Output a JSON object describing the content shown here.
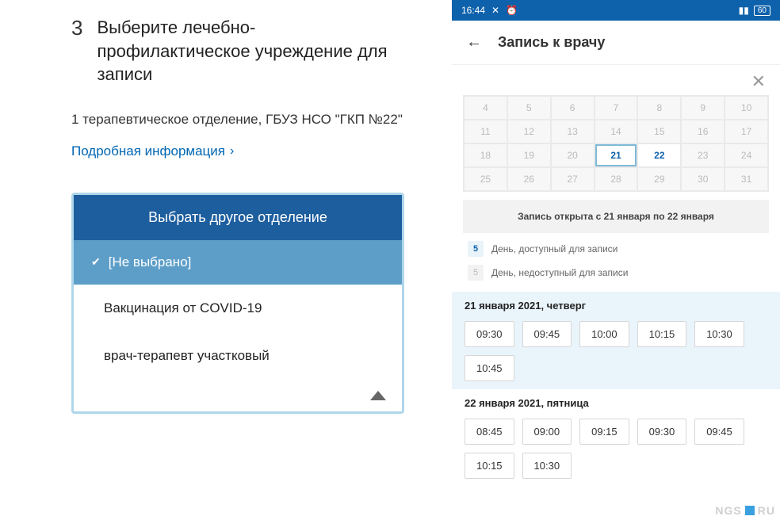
{
  "left": {
    "step_number": "3",
    "step_title": "Выберите лечебно-профилактическое учреждение для записи",
    "department": "1 терапевтическое отделение, ГБУЗ НСО \"ГКП №22\"",
    "details_link": "Подробная информация",
    "dropdown": {
      "header": "Выбрать другое отделение",
      "selected": "[Не выбрано]",
      "options": [
        "Вакцинация от COVID-19",
        "врач-терапевт участковый"
      ]
    }
  },
  "right": {
    "status": {
      "time": "16:44",
      "battery": "60"
    },
    "appbar_title": "Запись к врачу",
    "calendar": {
      "cells": [
        {
          "d": "4"
        },
        {
          "d": "5"
        },
        {
          "d": "6"
        },
        {
          "d": "7"
        },
        {
          "d": "8"
        },
        {
          "d": "9"
        },
        {
          "d": "10"
        },
        {
          "d": "11"
        },
        {
          "d": "12"
        },
        {
          "d": "13"
        },
        {
          "d": "14"
        },
        {
          "d": "15"
        },
        {
          "d": "16"
        },
        {
          "d": "17"
        },
        {
          "d": "18"
        },
        {
          "d": "19"
        },
        {
          "d": "20"
        },
        {
          "d": "21",
          "avail": true,
          "selected": true
        },
        {
          "d": "22",
          "avail": true
        },
        {
          "d": "23"
        },
        {
          "d": "24"
        },
        {
          "d": "25"
        },
        {
          "d": "26"
        },
        {
          "d": "27"
        },
        {
          "d": "28"
        },
        {
          "d": "29"
        },
        {
          "d": "30"
        },
        {
          "d": "31"
        }
      ]
    },
    "banner": "Запись открыта с 21 января по 22 января",
    "legend": {
      "avail_num": "5",
      "avail_text": "День, доступный для записи",
      "unavail_num": "5",
      "unavail_text": "День, недоступный для записи"
    },
    "days": [
      {
        "title": "21 января 2021, четверг",
        "highlight": true,
        "slots": [
          "09:30",
          "09:45",
          "10:00",
          "10:15",
          "10:30",
          "10:45"
        ]
      },
      {
        "title": "22 января 2021, пятница",
        "highlight": false,
        "slots": [
          "08:45",
          "09:00",
          "09:15",
          "09:30",
          "09:45",
          "10:15",
          "10:30"
        ]
      }
    ],
    "watermark": {
      "a": "NGS",
      "b": "RU"
    }
  }
}
